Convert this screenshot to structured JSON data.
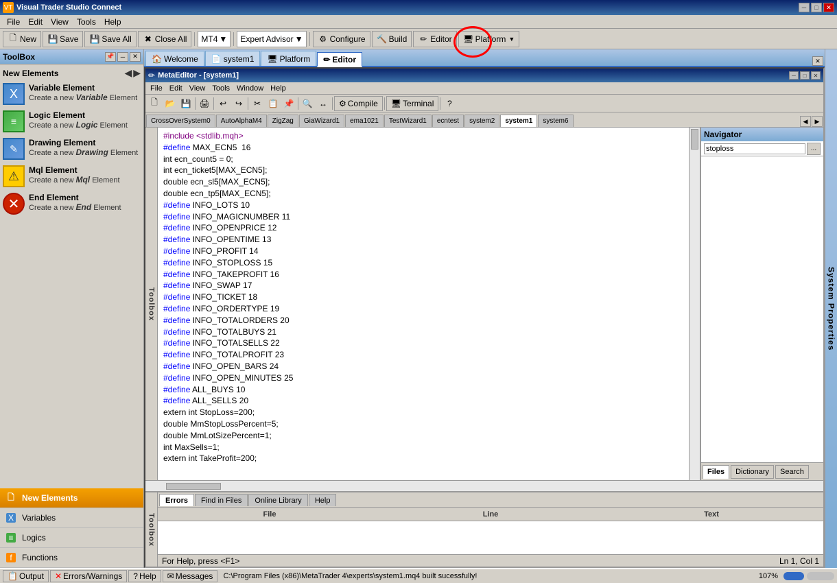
{
  "app": {
    "title": "Visual Trader Studio Connect",
    "title_icon": "VT"
  },
  "title_bar": {
    "title": "Visual Trader Studio Connect",
    "controls": [
      "─",
      "□",
      "✕"
    ]
  },
  "menu": {
    "items": [
      "File",
      "Edit",
      "View",
      "Tools",
      "Help"
    ]
  },
  "toolbar": {
    "new_label": "New",
    "save_label": "Save",
    "save_all_label": "Save All",
    "close_all_label": "Close All",
    "platform_dropdown": "MT4",
    "expert_advisor": "Expert Advisor",
    "configure_label": "Configure",
    "build_label": "Build",
    "editor_label": "Editor",
    "platform_label": "Platform"
  },
  "left_panel": {
    "title": "ToolBox",
    "section_title": "New Elements",
    "elements": [
      {
        "name": "Variable Element",
        "desc": "Create a new Variable Element",
        "desc_bold": "Variable",
        "icon_type": "variable"
      },
      {
        "name": "Logic Element",
        "desc": "Create a new Logic Element",
        "desc_bold": "Logic",
        "icon_type": "logic"
      },
      {
        "name": "Drawing Element",
        "desc": "Create a new Drawing Element",
        "desc_bold": "Drawing",
        "icon_type": "drawing"
      },
      {
        "name": "Mql Element",
        "desc": "Create a new Mql Element",
        "desc_bold": "Mql",
        "icon_type": "mql"
      },
      {
        "name": "End Element",
        "desc": "Create a new End Element",
        "desc_bold": "End",
        "icon_type": "end"
      }
    ],
    "nav_items": [
      {
        "label": "New Elements",
        "active": true
      },
      {
        "label": "Variables",
        "active": false
      },
      {
        "label": "Logics",
        "active": false
      },
      {
        "label": "Functions",
        "active": false
      }
    ]
  },
  "tabs": {
    "items": [
      {
        "label": "Welcome",
        "active": false,
        "icon": "🏠"
      },
      {
        "label": "system1",
        "active": false,
        "icon": "📄"
      },
      {
        "label": "Platform",
        "active": false,
        "icon": "🖥"
      },
      {
        "label": "Editor",
        "active": true,
        "icon": "✏"
      }
    ]
  },
  "meta_editor": {
    "title": "MetaEditor - [system1]",
    "menu": [
      "File",
      "Edit",
      "View",
      "Tools",
      "Window",
      "Help"
    ],
    "file_tabs": [
      "CrossOverSystem0",
      "AutoAlphaM4",
      "ZigZag",
      "GiaWizard1",
      "ema1021",
      "TestWizard1",
      "ecntest",
      "system2",
      "system1",
      "system6"
    ],
    "active_tab": "system1"
  },
  "navigator": {
    "title": "Navigator",
    "search_value": "stoploss",
    "footer_tabs": [
      "Files",
      "Dictionary",
      "Search"
    ]
  },
  "code": {
    "lines": [
      "#include <stdlib.mqh>",
      "#define MAX_ECN5  16",
      "int ecn_count5 = 0;",
      "int ecn_ticket5[MAX_ECN5];",
      "double ecn_sl5[MAX_ECN5];",
      "double ecn_tp5[MAX_ECN5];",
      "#define INFO_LOTS 10",
      "#define INFO_MAGICNUMBER 11",
      "#define INFO_OPENPRICE 12",
      "#define INFO_OPENTIME 13",
      "#define INFO_PROFIT 14",
      "#define INFO_STOPLOSS 15",
      "#define INFO_TAKEPROFIT 16",
      "#define INFO_SWAP 17",
      "#define INFO_TICKET 18",
      "#define INFO_ORDERTYPE 19",
      "#define INFO_TOTALORDERS 20",
      "#define INFO_TOTALBUYS 21",
      "#define INFO_TOTALSELLS 22",
      "#define INFO_TOTALPROFIT 23",
      "#define INFO_OPEN_BARS 24",
      "#define INFO_OPEN_MINUTES 25",
      "#define ALL_BUYS 10",
      "#define ALL_SELLS 20",
      "extern int StopLoss=200;",
      "double MmStopLossPercent=5;",
      "double MmLotSizePercent=1;",
      "int MaxSells=1;",
      "extern int TakeProfit=200;"
    ]
  },
  "bottom_tabs": {
    "items": [
      "Errors",
      "Find in Files",
      "Online Library",
      "Help"
    ],
    "columns": [
      "File",
      "Line",
      "Text"
    ]
  },
  "status_bar": {
    "tabs": [
      "Output",
      "Errors/Warnings",
      "Help",
      "Messages"
    ],
    "message": "C:\\Program Files (x86)\\MetaTrader 4\\experts\\system1.mq4 built sucessfully!",
    "zoom": "107%",
    "position": "Ln 1, Col 1"
  },
  "system_props": {
    "label": "System Properties"
  },
  "toolbox_side": {
    "label": "Toolbox"
  }
}
